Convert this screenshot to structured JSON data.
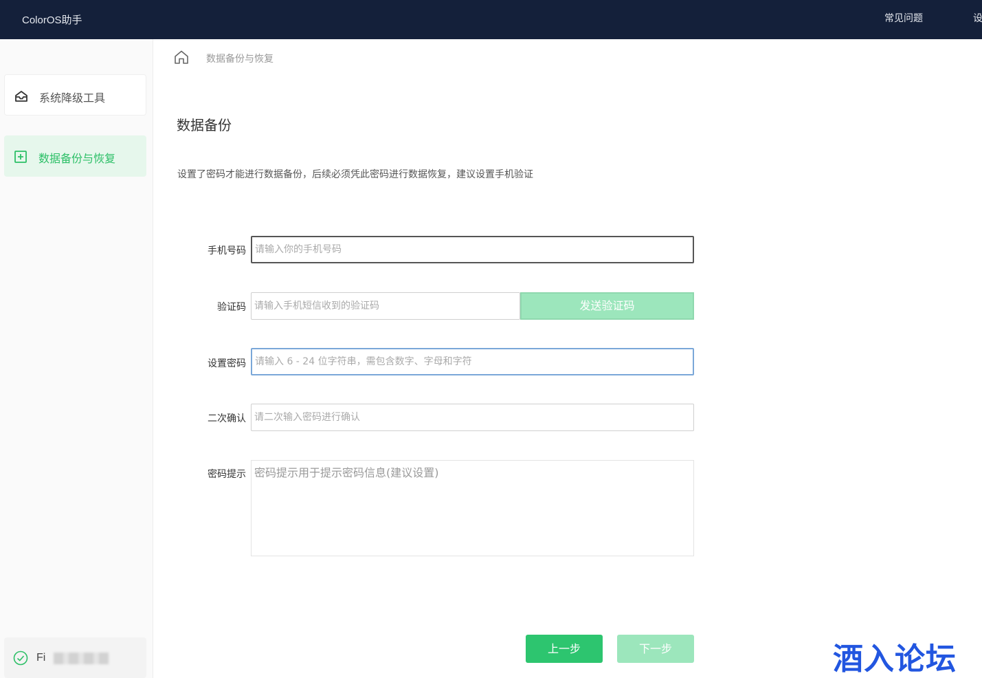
{
  "app": {
    "title": "ColorOS助手"
  },
  "topnav": {
    "faq": "常见问题",
    "settings": "设置"
  },
  "sidebar": {
    "items": [
      {
        "label": "系统降级工具",
        "icon": "downgrade-icon"
      },
      {
        "label": "数据备份与恢复",
        "icon": "backup-icon",
        "active": true
      }
    ],
    "device": {
      "name_visible": "Fi",
      "status_icon": "check-circle-icon"
    }
  },
  "breadcrumb": {
    "current": "数据备份与恢复"
  },
  "page": {
    "title": "数据备份",
    "description": "设置了密码才能进行数据备份，后续必须凭此密码进行数据恢复，建议设置手机验证"
  },
  "form": {
    "phone": {
      "label": "手机号码",
      "placeholder": "请输入你的手机号码"
    },
    "code": {
      "label": "验证码",
      "placeholder": "请输入手机短信收到的验证码",
      "send_button": "发送验证码"
    },
    "password": {
      "label": "设置密码",
      "placeholder": "请输入 6 - 24 位字符串，需包含数字、字母和字符"
    },
    "confirm": {
      "label": "二次确认",
      "placeholder": "请二次输入密码进行确认"
    },
    "hint": {
      "label": "密码提示",
      "placeholder": "密码提示用于提示密码信息(建议设置)"
    }
  },
  "buttons": {
    "prev": "上一步",
    "next": "下一步"
  },
  "watermark": "酒入论坛",
  "colors": {
    "topbar": "#14203a",
    "accent_green": "#2dc56f",
    "accent_green_light": "#9ce6bc",
    "watermark_blue": "#2256e0"
  }
}
